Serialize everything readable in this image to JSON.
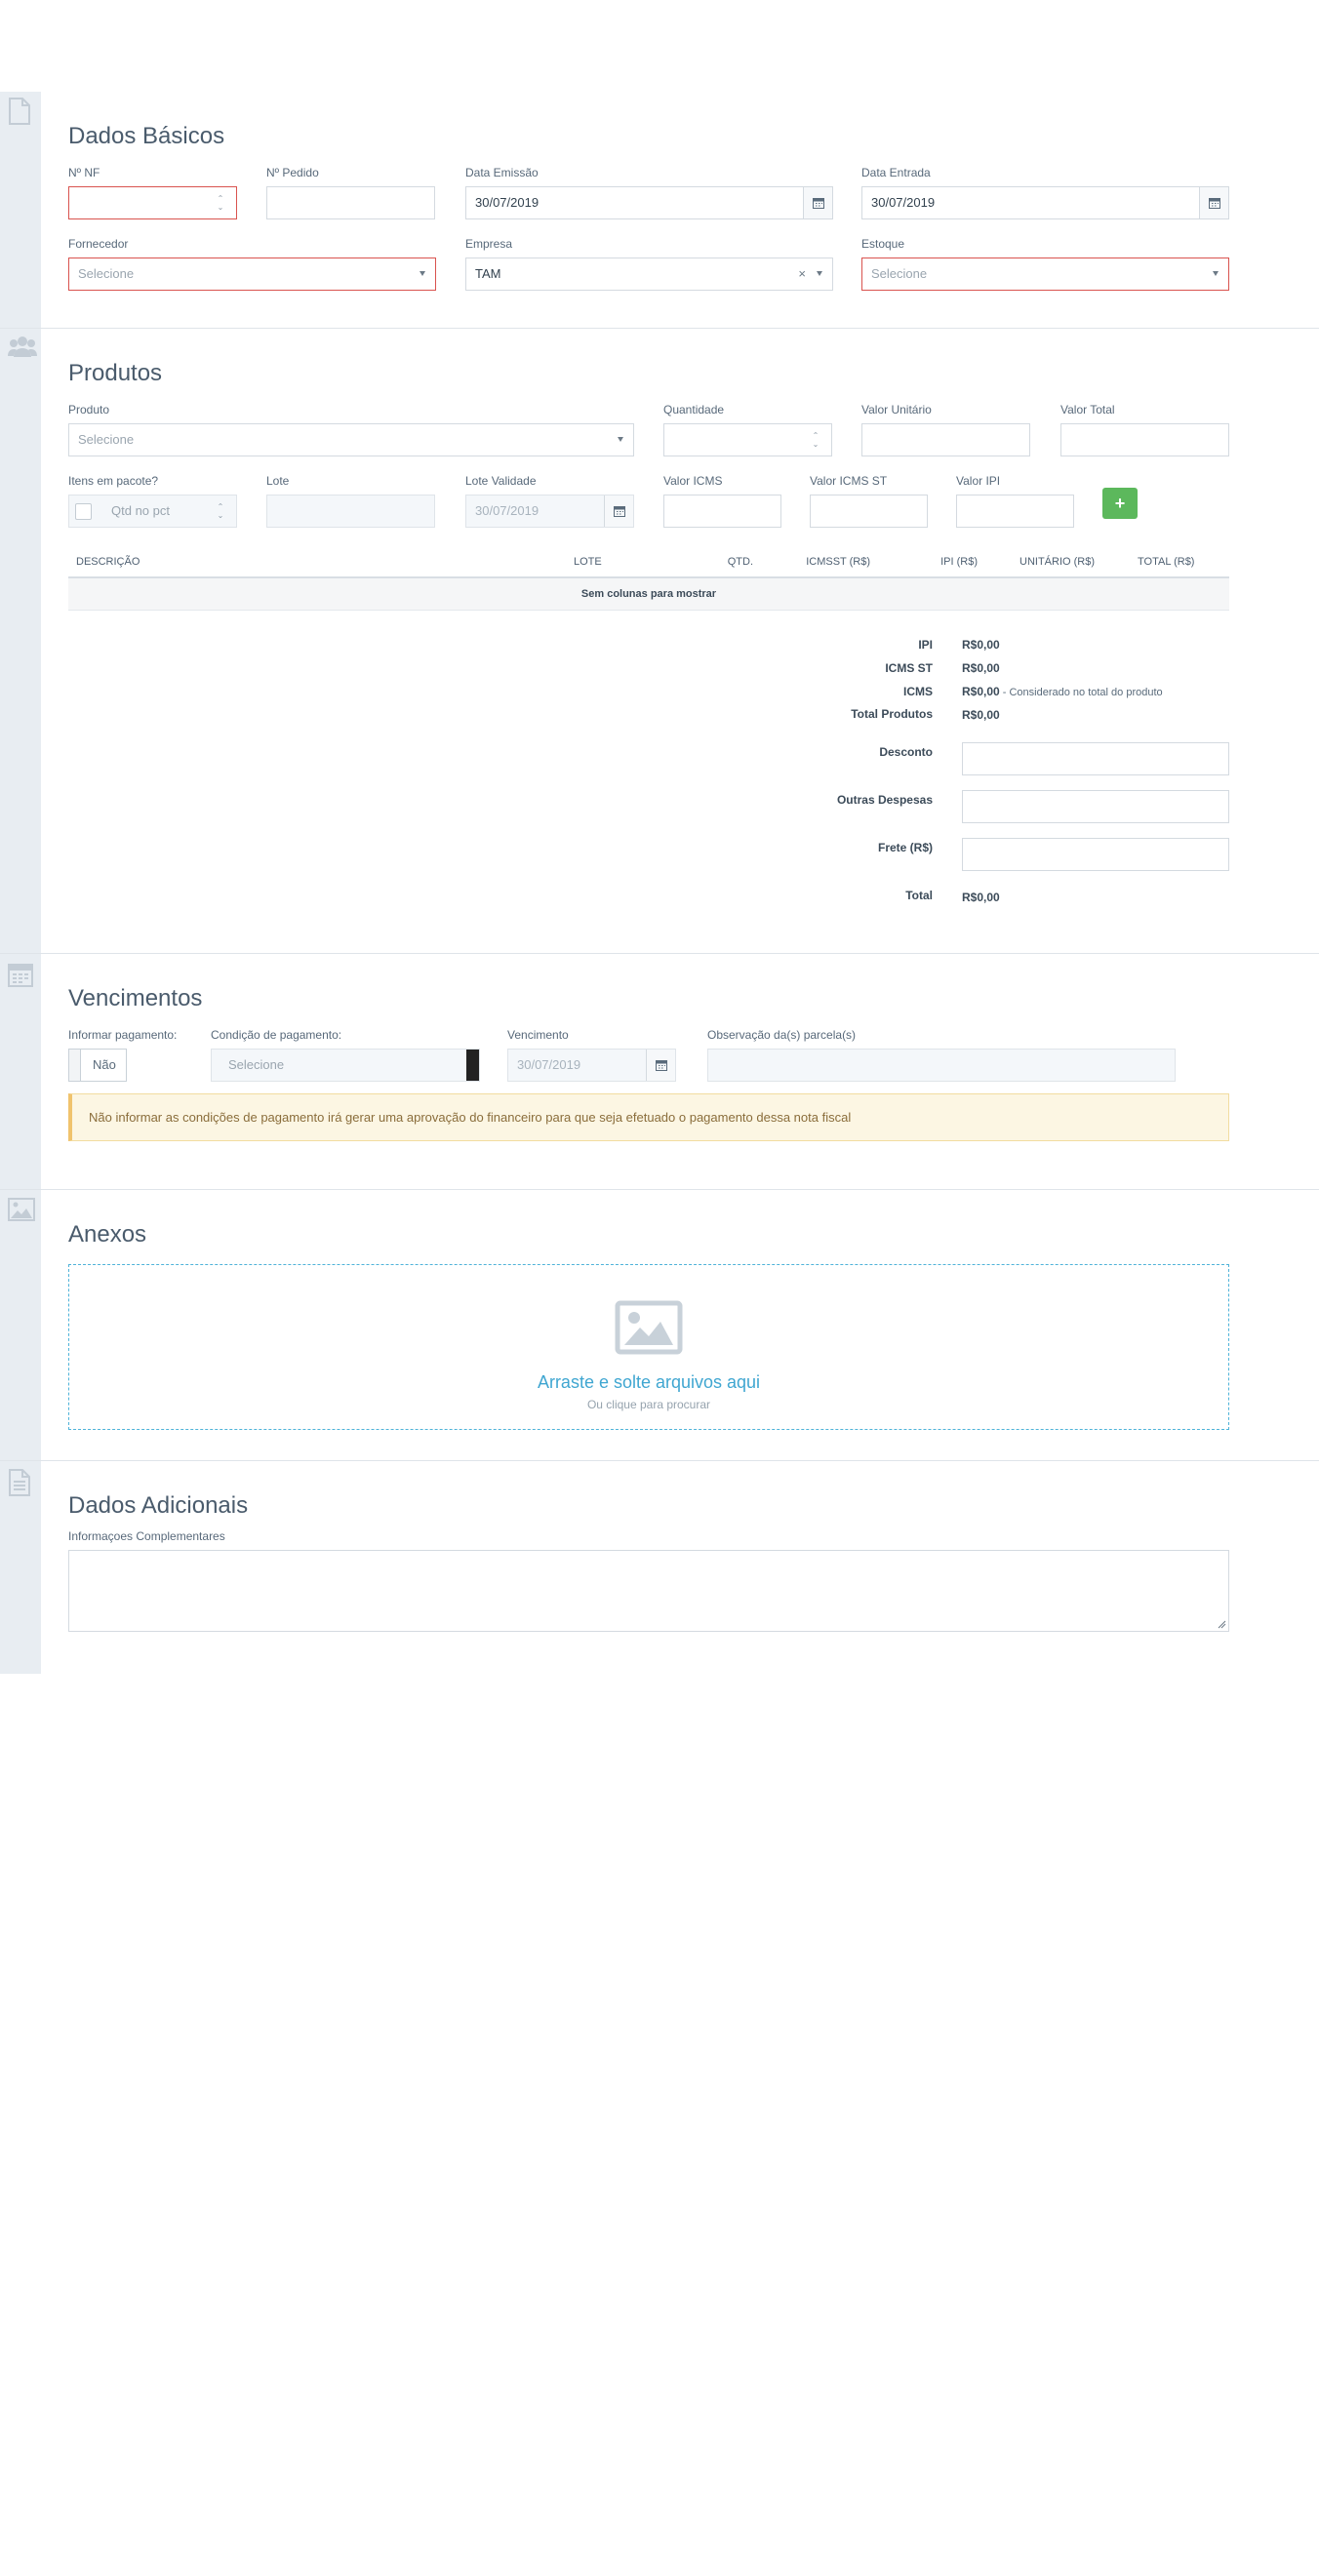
{
  "dados_basicos": {
    "title": "Dados Básicos",
    "nf_label": "Nº NF",
    "nf_value": "",
    "pedido_label": "Nº Pedido",
    "pedido_value": "",
    "emissao_label": "Data Emissão",
    "emissao_value": "30/07/2019",
    "entrada_label": "Data Entrada",
    "entrada_value": "30/07/2019",
    "fornecedor_label": "Fornecedor",
    "fornecedor_placeholder": "Selecione",
    "empresa_label": "Empresa",
    "empresa_value": "TAM",
    "estoque_label": "Estoque",
    "estoque_placeholder": "Selecione"
  },
  "produtos": {
    "title": "Produtos",
    "produto_label": "Produto",
    "produto_placeholder": "Selecione",
    "quantidade_label": "Quantidade",
    "valor_unitario_label": "Valor Unitário",
    "valor_total_label": "Valor Total",
    "itens_pacote_label": "Itens em pacote?",
    "qtd_pct_placeholder": "Qtd no pct",
    "lote_label": "Lote",
    "lote_validade_label": "Lote Validade",
    "lote_validade_value": "30/07/2019",
    "valor_icms_label": "Valor ICMS",
    "valor_icms_st_label": "Valor ICMS ST",
    "valor_ipi_label": "Valor IPI",
    "add_label": "+",
    "columns": [
      "DESCRIÇÃO",
      "LOTE",
      "QTD.",
      "ICMSST (R$)",
      "IPI (R$)",
      "UNITÁRIO (R$)",
      "TOTAL (R$)"
    ],
    "empty_message": "Sem colunas para mostrar"
  },
  "totais": {
    "ipi_label": "IPI",
    "ipi_value": "R$0,00",
    "icms_st_label": "ICMS ST",
    "icms_st_value": "R$0,00",
    "icms_label": "ICMS",
    "icms_value": "R$0,00",
    "icms_note": " - Considerado no total do produto",
    "total_produtos_label": "Total Produtos",
    "total_produtos_value": "R$0,00",
    "desconto_label": "Desconto",
    "outras_despesas_label": "Outras Despesas",
    "frete_label": "Frete (R$)",
    "total_label": "Total",
    "total_value": "R$0,00"
  },
  "vencimentos": {
    "title": "Vencimentos",
    "informar_label": "Informar pagamento:",
    "informar_toggle": "Não",
    "condicao_label": "Condição de pagamento:",
    "condicao_placeholder": "Selecione",
    "vencimento_label": "Vencimento",
    "vencimento_value": "30/07/2019",
    "observacao_label": "Observação da(s) parcela(s)",
    "alert": "Não informar as condições de pagamento irá gerar uma aprovação do financeiro para que seja efetuado o pagamento dessa nota fiscal"
  },
  "anexos": {
    "title": "Anexos",
    "drop_title": "Arraste e solte arquivos aqui",
    "drop_sub": "Ou clique para procurar"
  },
  "dados_adicionais": {
    "title": "Dados Adicionais",
    "info_label": "Informaçoes Complementares"
  },
  "colors": {
    "rail": "#e8edf2",
    "error": "#d9534f",
    "success": "#5cb85c",
    "link": "#3fa6d1",
    "warning_bg": "#fcf6e3"
  }
}
